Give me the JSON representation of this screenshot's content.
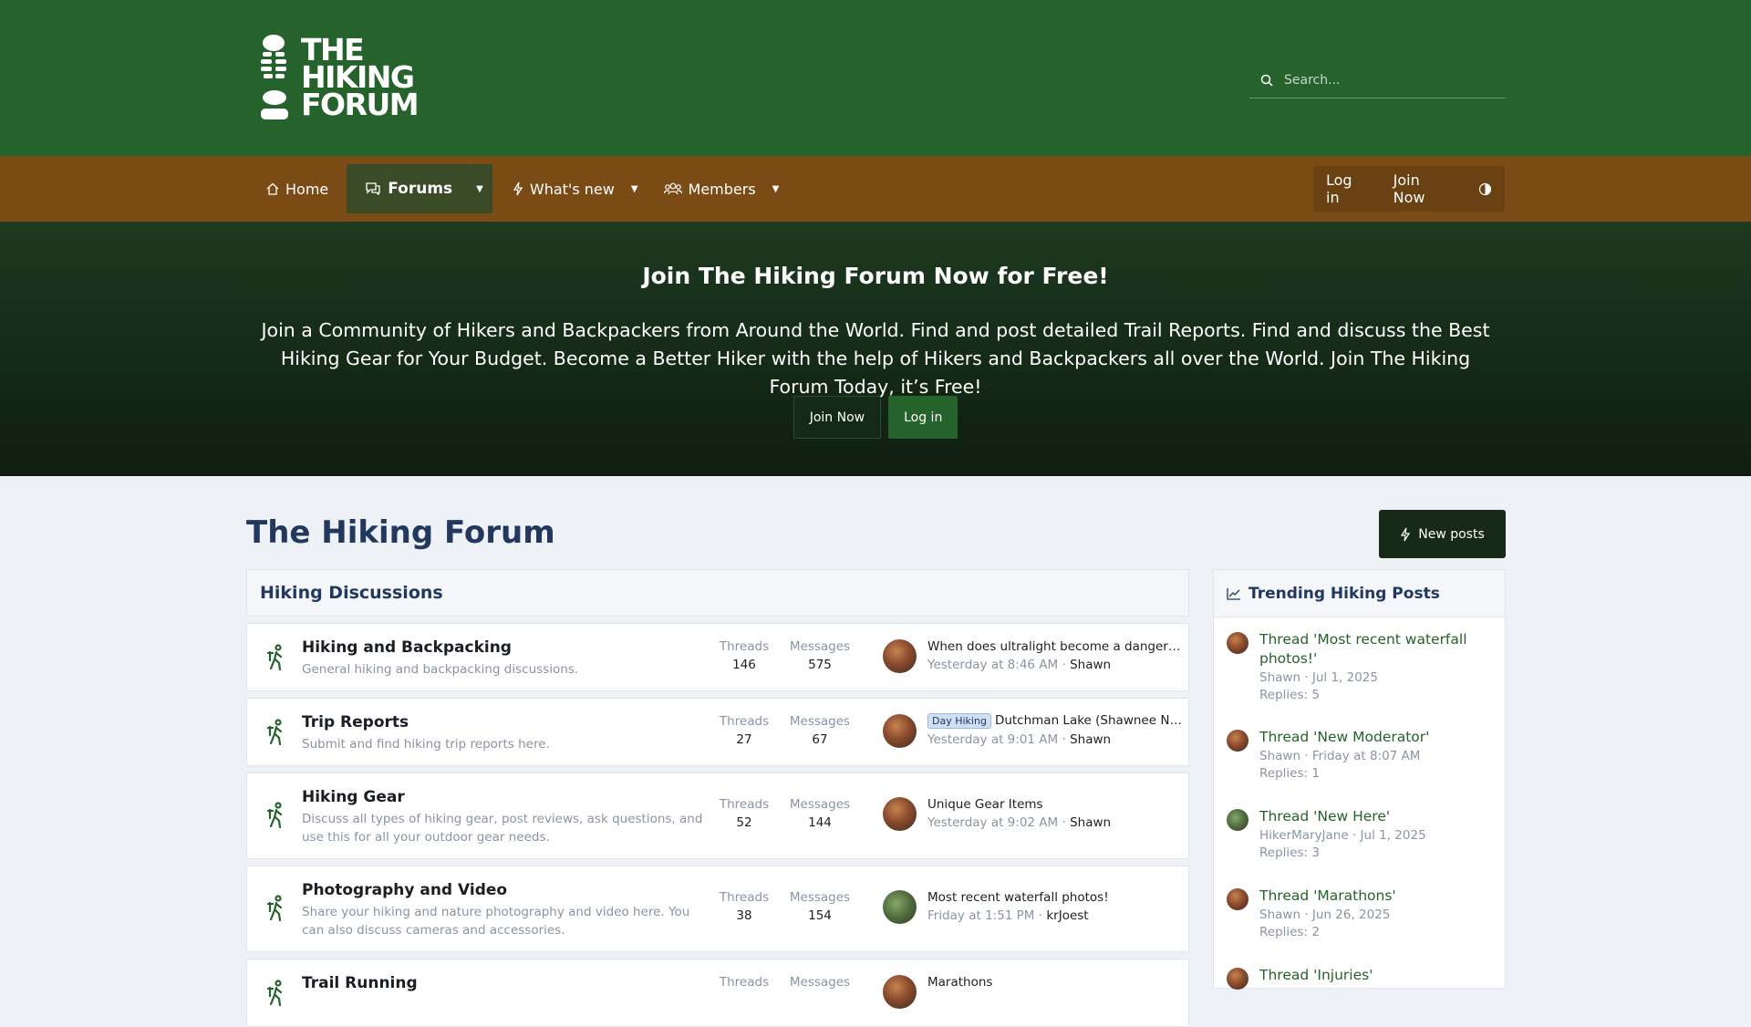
{
  "brand": {
    "logo_text": "THE\nHIKING\nFORUM"
  },
  "search": {
    "placeholder": "Search..."
  },
  "nav": {
    "home": "Home",
    "forums": "Forums",
    "whats_new": "What's new",
    "members": "Members",
    "login": "Log in",
    "join": "Join Now"
  },
  "hero": {
    "title": "Join The Hiking Forum Now for Free!",
    "text": "Join a Community of Hikers and Backpackers from Around the World. Find and post detailed Trail Reports. Find and discuss the Best Hiking Gear for Your Budget. Become a Better Hiker with the help of Hikers and Backpackers all over the World. Join The Hiking Forum Today, it’s Free!",
    "join_btn": "Join Now",
    "login_btn": "Log in"
  },
  "page": {
    "title": "The Hiking Forum",
    "new_posts": "New posts"
  },
  "block": {
    "title": "Hiking Discussions"
  },
  "labels": {
    "threads": "Threads",
    "messages": "Messages"
  },
  "forums": [
    {
      "title": "Hiking and Backpacking",
      "desc": "General hiking and backpacking discussions.",
      "threads": "146",
      "messages": "575",
      "last_prefix": "",
      "last_title": "When does ultralight become a danger…",
      "last_date": "Yesterday at 8:46 AM",
      "last_user": "Shawn"
    },
    {
      "title": "Trip Reports",
      "desc": "Submit and find hiking trip reports here.",
      "threads": "27",
      "messages": "67",
      "last_prefix": "Day Hiking",
      "last_title": "Dutchman Lake (Shawnee Na…",
      "last_date": "Yesterday at 9:01 AM",
      "last_user": "Shawn"
    },
    {
      "title": "Hiking Gear",
      "desc": "Discuss all types of hiking gear, post reviews, ask questions, and use this for all your outdoor gear needs.",
      "threads": "52",
      "messages": "144",
      "last_prefix": "",
      "last_title": "Unique Gear Items",
      "last_date": "Yesterday at 9:02 AM",
      "last_user": "Shawn"
    },
    {
      "title": "Photography and Video",
      "desc": "Share your hiking and nature photography and video here. You can also discuss cameras and accessories.",
      "threads": "38",
      "messages": "154",
      "last_prefix": "",
      "last_title": "Most recent waterfall photos!",
      "last_date": "Friday at 1:51 PM",
      "last_user": "krJoest"
    },
    {
      "title": "Trail Running",
      "desc": "",
      "threads": "",
      "messages": "",
      "last_prefix": "",
      "last_title": "Marathons",
      "last_date": "",
      "last_user": ""
    }
  ],
  "sidebar": {
    "title": "Trending Hiking Posts",
    "items": [
      {
        "title": "Thread 'Most recent waterfall photos!'",
        "user": "Shawn",
        "date": "Jul 1, 2025",
        "replies": "Replies: 5"
      },
      {
        "title": "Thread 'New Moderator'",
        "user": "Shawn",
        "date": "Friday at 8:07 AM",
        "replies": "Replies: 1"
      },
      {
        "title": "Thread 'New Here'",
        "user": "HikerMaryJane",
        "date": "Jul 1, 2025",
        "replies": "Replies: 3"
      },
      {
        "title": "Thread 'Marathons'",
        "user": "Shawn",
        "date": "Jun 26, 2025",
        "replies": "Replies: 2"
      },
      {
        "title": "Thread 'Injuries'",
        "user": "",
        "date": "",
        "replies": ""
      }
    ]
  },
  "icons": {
    "search": "search-icon",
    "home": "home-icon",
    "forums": "chat-bubbles-icon",
    "whats_new": "bolt-icon",
    "members": "users-icon",
    "theme": "theme-toggle-icon",
    "forum_node": "hiker-icon",
    "trending": "trending-chart-icon"
  },
  "colors": {
    "header_green": "#26622b",
    "nav_brown": "#7a4b14",
    "title_navy": "#22385e",
    "link_green": "#26622b"
  }
}
